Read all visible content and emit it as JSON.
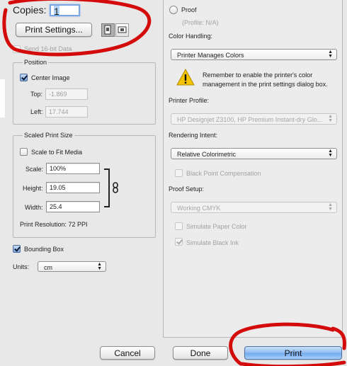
{
  "copies": {
    "label": "Copies:",
    "value": "1"
  },
  "print_settings_button": "Print Settings...",
  "send_16bit": {
    "label": "Send 16-bit Data",
    "checked": false,
    "disabled": true
  },
  "position": {
    "legend": "Position",
    "center_image": {
      "label": "Center Image",
      "checked": true
    },
    "top": {
      "label": "Top:",
      "value": "-1.869"
    },
    "left": {
      "label": "Left:",
      "value": "17.744"
    }
  },
  "scaled_print_size": {
    "legend": "Scaled Print Size",
    "scale_to_fit": {
      "label": "Scale to Fit Media",
      "checked": false
    },
    "scale": {
      "label": "Scale:",
      "value": "100%"
    },
    "height": {
      "label": "Height:",
      "value": "19.05"
    },
    "width": {
      "label": "Width:",
      "value": "25.4"
    },
    "resolution": "Print Resolution: 72 PPI"
  },
  "bounding_box": {
    "label": "Bounding Box",
    "checked": true
  },
  "units": {
    "label": "Units:",
    "value": "cm"
  },
  "proof": {
    "label": "Proof",
    "profile": "(Profile: N/A)"
  },
  "color_handling": {
    "label": "Color Handling:",
    "value": "Printer Manages Colors"
  },
  "warning": "Remember to enable the printer's color management in the print settings dialog box.",
  "printer_profile": {
    "label": "Printer Profile:",
    "value": "HP Designjet Z3100, HP Premium Instant-dry Glo..."
  },
  "rendering_intent": {
    "label": "Rendering Intent:",
    "value": "Relative Colorimetric"
  },
  "black_point": {
    "label": "Black Point Compensation"
  },
  "proof_setup": {
    "label": "Proof Setup:",
    "value": "Working CMYK",
    "simulate_paper": "Simulate Paper Color",
    "simulate_ink": "Simulate Black Ink"
  },
  "buttons": {
    "cancel": "Cancel",
    "done": "Done",
    "print": "Print"
  },
  "colors": {
    "annotation_red": "#d40b0b",
    "primary_blue": "#8fbdf1",
    "warning_yellow": "#f5c400"
  },
  "icons": [
    "page-setup-icon",
    "printer-preset-icon",
    "warning-icon",
    "link-chain-icon",
    "popup-arrows-icon"
  ]
}
